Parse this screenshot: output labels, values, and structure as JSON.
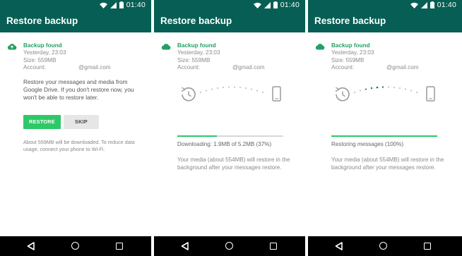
{
  "colors": {
    "toolbar": "#075e54",
    "accent": "#25a065",
    "button": "#2ec868"
  },
  "icons": [
    "cloud-icon",
    "wifi-icon",
    "signal-icon",
    "battery-icon",
    "history-icon",
    "phone-icon",
    "back-icon",
    "home-icon",
    "recents-icon"
  ],
  "status": {
    "time": "01:40"
  },
  "title": "Restore backup",
  "backup": {
    "found": "Backup found",
    "date": "Yesterday, 23:03",
    "size": "Size: 559MB",
    "account_label": "Account:",
    "account_domain": "@gmail.com"
  },
  "screen1": {
    "body": "Restore your messages and media from Google Drive. If you don't restore now, you won't be able to restore later.",
    "restore_label": "RESTORE",
    "skip_label": "SKIP",
    "note": "About 559MB will be downloaded. To reduce data usage, connect your phone to Wi-Fi."
  },
  "screen2": {
    "progress_text": "Downloading: 1.9MB of 5.2MB (37%)",
    "progress_value": 0.37,
    "media_note": "Your media (about 554MB) will restore in the background after your messages restore."
  },
  "screen3": {
    "progress_text": "Restoring messages (100%)",
    "progress_value": 1.0,
    "media_note": "Your media (about 554MB) will restore in the background after your messages restore."
  }
}
